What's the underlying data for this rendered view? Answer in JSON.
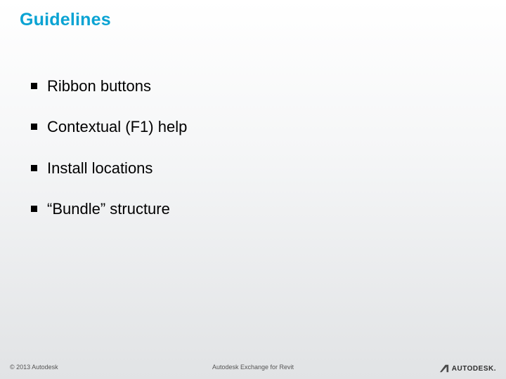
{
  "title": "Guidelines",
  "bullets": [
    {
      "text": "Ribbon buttons"
    },
    {
      "text": "Contextual (F1) help"
    },
    {
      "text": "Install locations"
    },
    {
      "text": "“Bundle” structure"
    }
  ],
  "footer": {
    "copyright": "© 2013 Autodesk",
    "center": "Autodesk Exchange for Revit",
    "brand": "AUTODESK."
  },
  "colors": {
    "accent": "#0aa3d3",
    "text": "#000000",
    "footer": "#555555"
  }
}
